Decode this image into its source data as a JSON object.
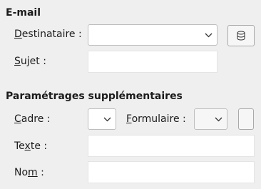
{
  "email_section": {
    "title": "E-mail",
    "recipient": {
      "mnemonic": "D",
      "rest": "estinataire :",
      "value": ""
    },
    "subject": {
      "mnemonic": "S",
      "rest": "ujet :",
      "value": ""
    }
  },
  "extra_section": {
    "title": "Paramétrages supplémentaires",
    "frame": {
      "mnemonic": "C",
      "rest": "adre :",
      "value": ""
    },
    "form": {
      "mnemonic": "F",
      "rest": "ormulaire :",
      "value": ""
    },
    "text": {
      "pre": "Te",
      "mnemonic": "x",
      "rest": "te :",
      "value": ""
    },
    "name": {
      "pre": "No",
      "mnemonic": "m",
      "rest": " :",
      "value": ""
    }
  },
  "icons": {
    "address_book": "database-icon",
    "dropdown": "chevron-down-icon"
  }
}
